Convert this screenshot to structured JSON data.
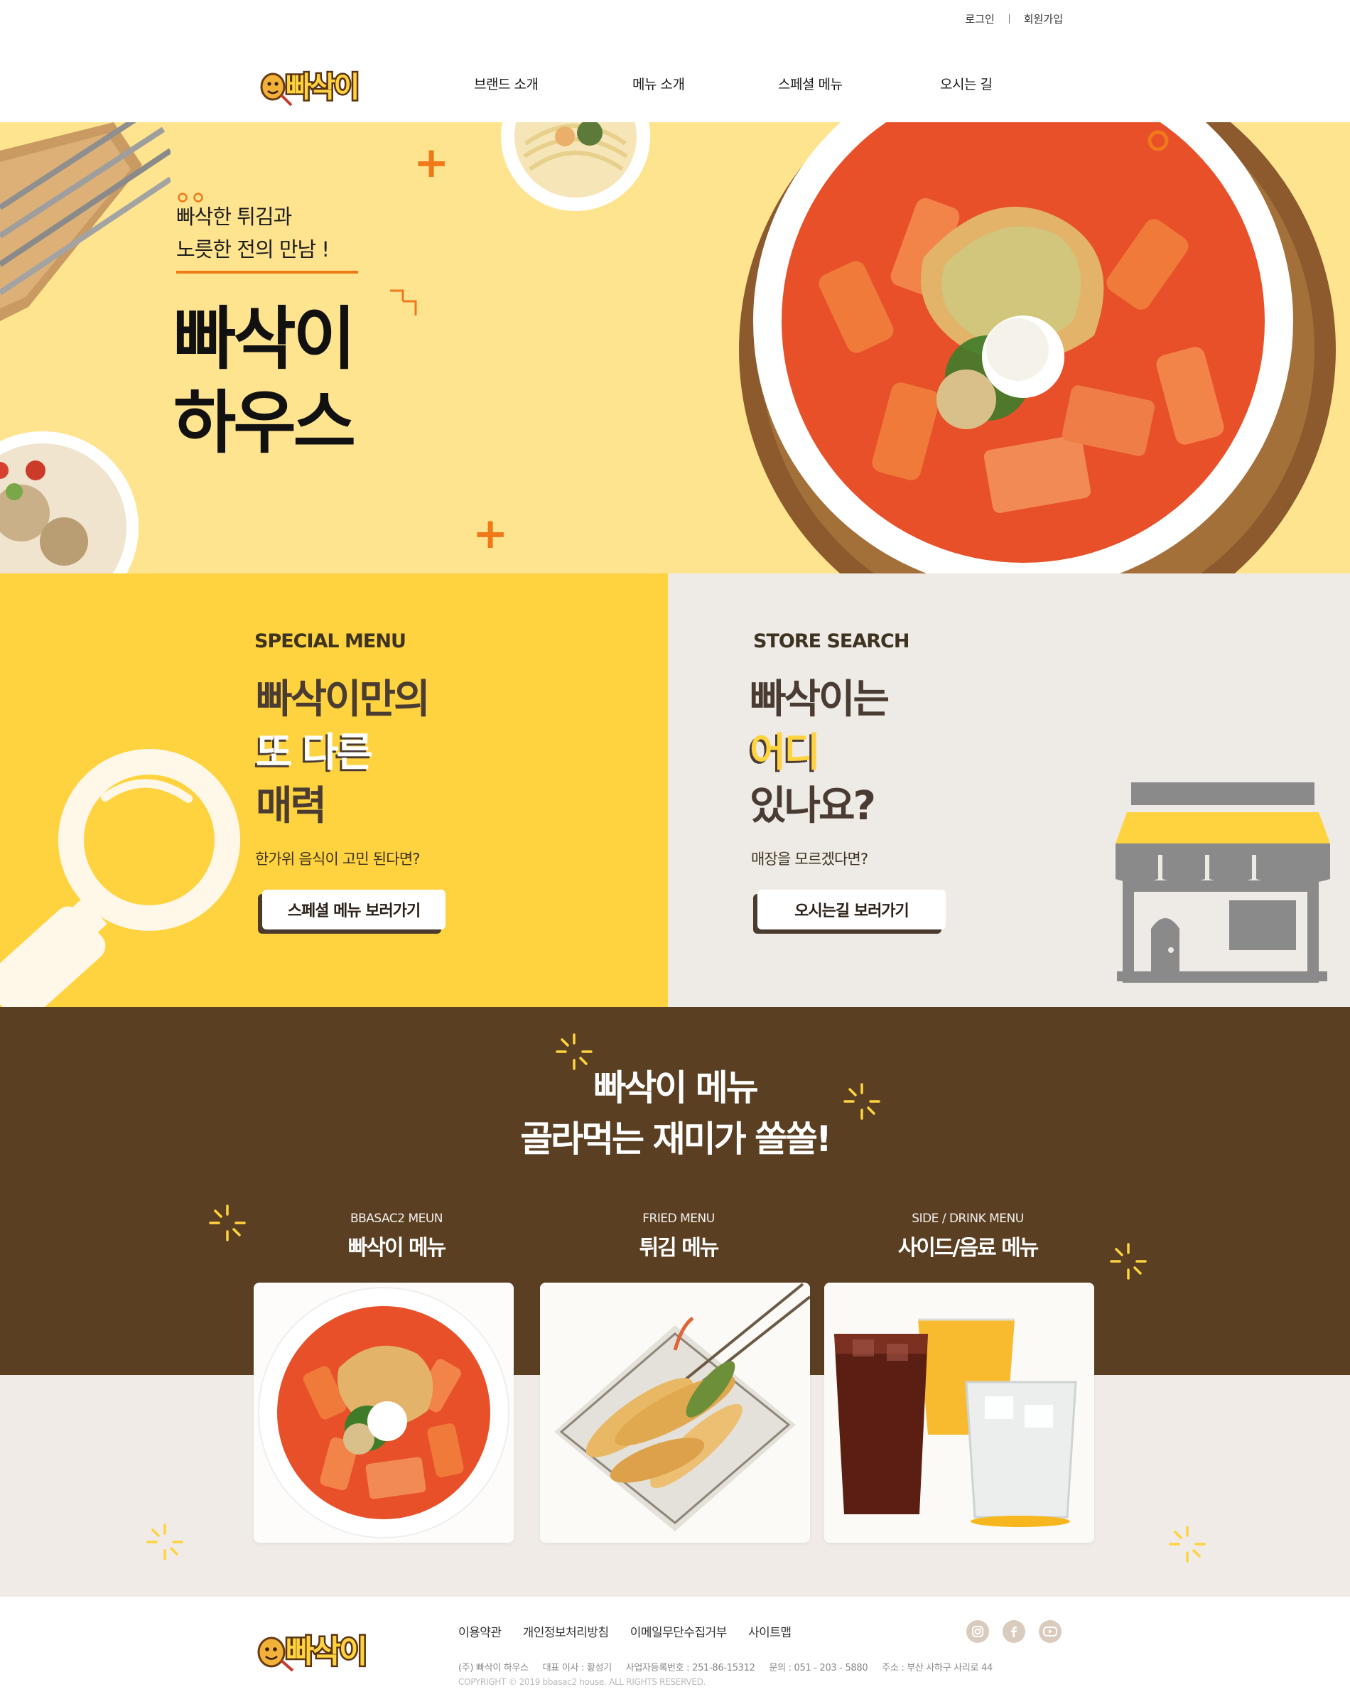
{
  "top_links": {
    "login": "로그인",
    "signup": "회원가입"
  },
  "brand": {
    "logo_text": "빠삭이"
  },
  "nav": [
    {
      "label": "브랜드 소개"
    },
    {
      "label": "메뉴 소개"
    },
    {
      "label": "스페셜 메뉴"
    },
    {
      "label": "오시는 길"
    }
  ],
  "hero": {
    "subtitle_line1": "빠삭한 튀김과",
    "subtitle_line2": "노릇한 전의 만남 !",
    "title_line1": "빠삭이",
    "title_line2": "하우스"
  },
  "special": {
    "eyebrow": "SPECIAL MENU",
    "heading_line1": "빠삭이만의",
    "heading_line2": "또 다른",
    "heading_line3": "매력",
    "description": "한가위 음식이 고민 된다면?",
    "button_label": "스페셜 메뉴 보러가기"
  },
  "store": {
    "eyebrow": "STORE SEARCH",
    "heading_line1": "빠삭이는",
    "heading_line2": "어디",
    "heading_line3": "있나요?",
    "description": "매장을 모르겠다면?",
    "button_label": "오시는길 보러가기"
  },
  "menu_section": {
    "title_line1": "빠삭이 메뉴",
    "title_line2": "골라먹는 재미가 쏠쏠!",
    "categories": [
      {
        "en": "BBASAC2 MEUN",
        "ko": "빠삭이 메뉴"
      },
      {
        "en": "FRIED MENU",
        "ko": "튀김 메뉴"
      },
      {
        "en": "SIDE / DRINK MENU",
        "ko": "사이드/음료 메뉴"
      }
    ]
  },
  "footer": {
    "logo_text": "빠삭이",
    "links": [
      "이용약관",
      "개인정보처리방침",
      "이메일무단수집거부",
      "사이트맵"
    ],
    "company": "(주) 빠삭이 하우스",
    "ceo": "대표 이사 : 황성기",
    "biz_no": "사업자등록번호 : 251-86-15312",
    "phone": "문의 : 051 - 203 - 5880",
    "address": "주소 : 부산 사하구 사리로 44",
    "copyright": "COPYRIGHT © 2019 bbasac2 house. ALL RIGHTS RESERVED.",
    "social_icons": [
      "instagram-icon",
      "facebook-icon",
      "youtube-icon"
    ]
  },
  "colors": {
    "hero_bg": "#ffe490",
    "special_bg": "#ffd33f",
    "store_bg": "#eeebe7",
    "menu_band": "#5a3f22",
    "menu_lower": "#f0ebe6",
    "accent_orange": "#f07a18",
    "sauce_red": "#e8502a"
  }
}
